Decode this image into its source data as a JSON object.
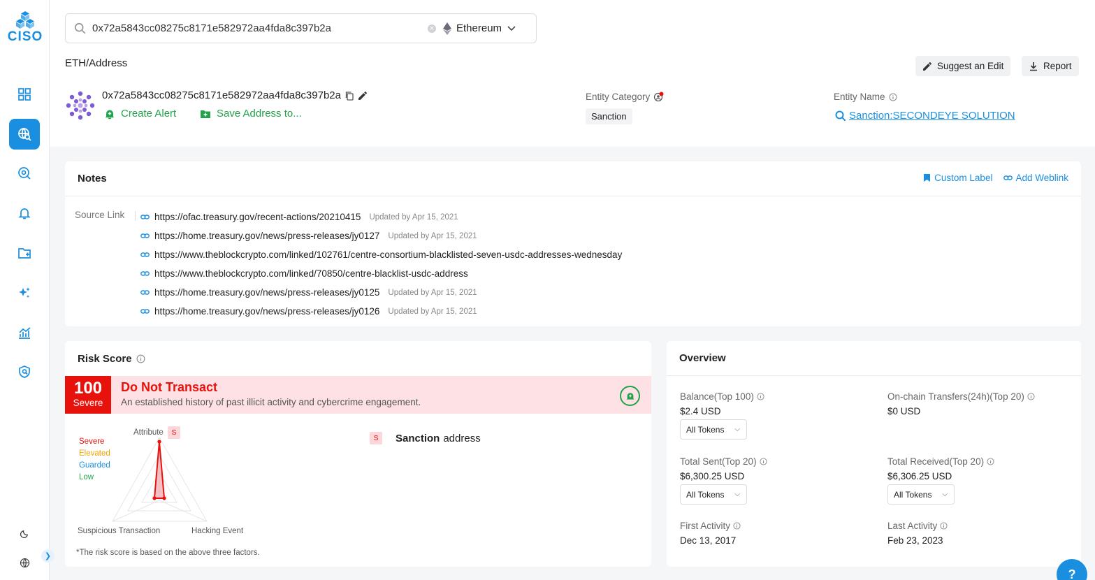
{
  "app": {
    "logo_text": "CISO"
  },
  "search": {
    "query": "0x72a5843cc08275c8171e582972aa4fda8c397b2a",
    "chain": "Ethereum"
  },
  "breadcrumb": "ETH/Address",
  "header_actions": {
    "suggest_edit": "Suggest an Edit",
    "report": "Report"
  },
  "address": {
    "hash": "0x72a5843cc08275c8171e582972aa4fda8c397b2a",
    "create_alert": "Create Alert",
    "save_address": "Save Address to..."
  },
  "entity": {
    "category_label": "Entity Category",
    "category_value": "Sanction",
    "name_label": "Entity Name",
    "name_value": "Sanction:SECONDEYE SOLUTION"
  },
  "notes": {
    "title": "Notes",
    "custom_label": "Custom Label",
    "add_weblink": "Add Weblink",
    "source_link_label": "Source Link",
    "links": [
      {
        "url": "https://ofac.treasury.gov/recent-actions/20210415",
        "updated": "Updated by Apr 15, 2021"
      },
      {
        "url": "https://home.treasury.gov/news/press-releases/jy0127",
        "updated": "Updated by Apr 15, 2021"
      },
      {
        "url": "https://www.theblockcrypto.com/linked/102761/centre-consortium-blacklisted-seven-usdc-addresses-wednesday",
        "updated": ""
      },
      {
        "url": "https://www.theblockcrypto.com/linked/70850/centre-blacklist-usdc-address",
        "updated": ""
      },
      {
        "url": "https://home.treasury.gov/news/press-releases/jy0125",
        "updated": "Updated by Apr 15, 2021"
      },
      {
        "url": "https://home.treasury.gov/news/press-releases/jy0126",
        "updated": "Updated by Apr 15, 2021"
      }
    ]
  },
  "risk": {
    "title": "Risk Score",
    "score": "100",
    "level": "Severe",
    "verdict": "Do Not Transact",
    "description": "An established history of past illicit activity and cybercrime engagement.",
    "legend": [
      "Severe",
      "Elevated",
      "Guarded",
      "Low"
    ],
    "legend_colors": [
      "#e8120c",
      "#f2a100",
      "#1a8fe0",
      "#22a34a"
    ],
    "axes": {
      "attribute": "Attribute",
      "suspicious": "Suspicious Transaction",
      "hacking": "Hacking Event"
    },
    "attribute_badge": "S",
    "sanction_badge": "S",
    "sanction_bold": "Sanction",
    "sanction_rest": "address",
    "footnote": "*The risk score is based on the above three factors."
  },
  "overview": {
    "title": "Overview",
    "balance_label": "Balance(Top 100)",
    "balance_value": "$2.4 USD",
    "transfers_label": "On-chain Transfers(24h)(Top 20)",
    "transfers_value": "$0 USD",
    "sent_label": "Total Sent(Top 20)",
    "sent_value": "$6,300.25 USD",
    "received_label": "Total Received(Top 20)",
    "received_value": "$6,306.25 USD",
    "first_label": "First Activity",
    "first_value": "Dec 13, 2017",
    "last_label": "Last Activity",
    "last_value": "Feb 23, 2023",
    "token_select": "All Tokens"
  },
  "colors": {
    "accent": "#1a8fe0",
    "danger": "#e8120c",
    "success": "#22a34a"
  }
}
